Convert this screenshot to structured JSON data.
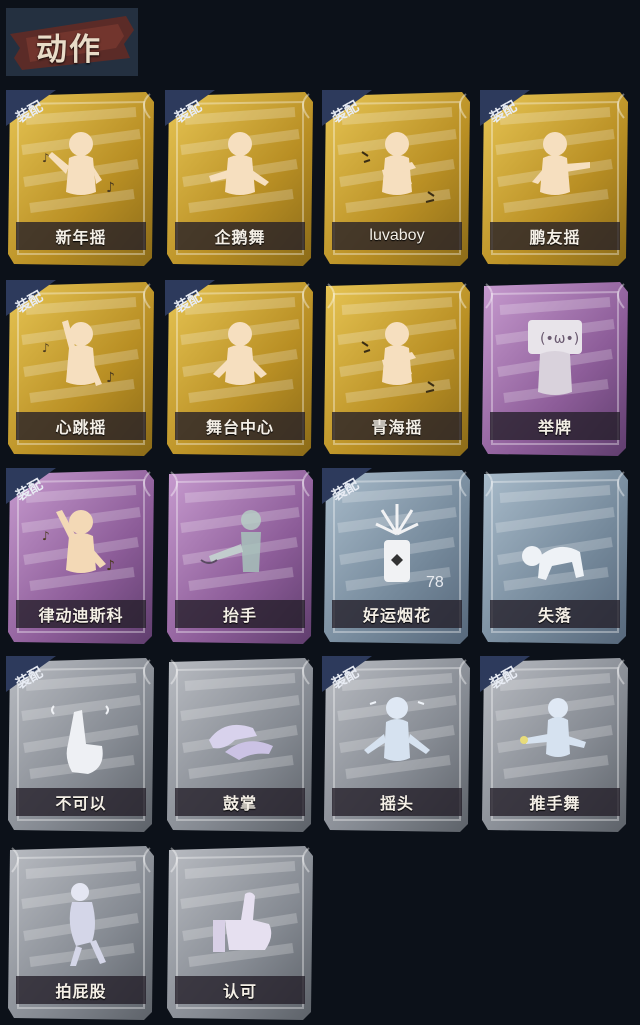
{
  "section": {
    "title": "动作"
  },
  "equipped_badge": "装配",
  "cards": [
    {
      "name": "新年摇",
      "rarity": "gold",
      "equipped": true,
      "icon": "dance-figure-music-icon"
    },
    {
      "name": "企鹅舞",
      "rarity": "gold",
      "equipped": true,
      "icon": "penguin-dance-figure-icon"
    },
    {
      "name": "luvaboy",
      "rarity": "gold",
      "equipped": true,
      "icon": "dance-figure-spark-icon"
    },
    {
      "name": "鹏友摇",
      "rarity": "gold",
      "equipped": true,
      "icon": "dance-figure-point-icon"
    },
    {
      "name": "心跳摇",
      "rarity": "gold",
      "equipped": true,
      "icon": "dance-figure-wave-icon"
    },
    {
      "name": "舞台中心",
      "rarity": "gold",
      "equipped": true,
      "icon": "dance-figure-center-icon"
    },
    {
      "name": "青海摇",
      "rarity": "gold",
      "equipped": false,
      "icon": "dance-figure-spark-icon"
    },
    {
      "name": "举牌",
      "rarity": "purple",
      "equipped": false,
      "icon": "hold-sign-icon"
    },
    {
      "name": "律动迪斯科",
      "rarity": "purple",
      "equipped": true,
      "icon": "disco-figure-icon"
    },
    {
      "name": "抬手",
      "rarity": "purple",
      "equipped": false,
      "icon": "raise-hand-figure-icon"
    },
    {
      "name": "好运烟花",
      "rarity": "blue",
      "equipped": true,
      "icon": "firework-can-icon",
      "count": "78"
    },
    {
      "name": "失落",
      "rarity": "blue",
      "equipped": false,
      "icon": "crawling-figure-icon"
    },
    {
      "name": "不可以",
      "rarity": "gray",
      "equipped": true,
      "icon": "finger-wag-icon"
    },
    {
      "name": "鼓掌",
      "rarity": "gray",
      "equipped": false,
      "icon": "clapping-hands-icon"
    },
    {
      "name": "摇头",
      "rarity": "gray",
      "equipped": true,
      "icon": "head-shake-figure-icon"
    },
    {
      "name": "推手舞",
      "rarity": "gray",
      "equipped": true,
      "icon": "push-hand-dance-icon"
    },
    {
      "name": "拍屁股",
      "rarity": "gray",
      "equipped": false,
      "icon": "butt-pat-figure-icon"
    },
    {
      "name": "认可",
      "rarity": "gray",
      "equipped": false,
      "icon": "thumbs-up-icon"
    }
  ],
  "colors": {
    "gold": [
      "#e7c554",
      "#b98f24",
      "#8a6a18"
    ],
    "purple": [
      "#c79bcf",
      "#8d5d99",
      "#5f3d6d"
    ],
    "blue": [
      "#a9bccb",
      "#75899b",
      "#56677a"
    ],
    "gray": [
      "#b9bcc2",
      "#858a92",
      "#5c6168"
    ]
  }
}
